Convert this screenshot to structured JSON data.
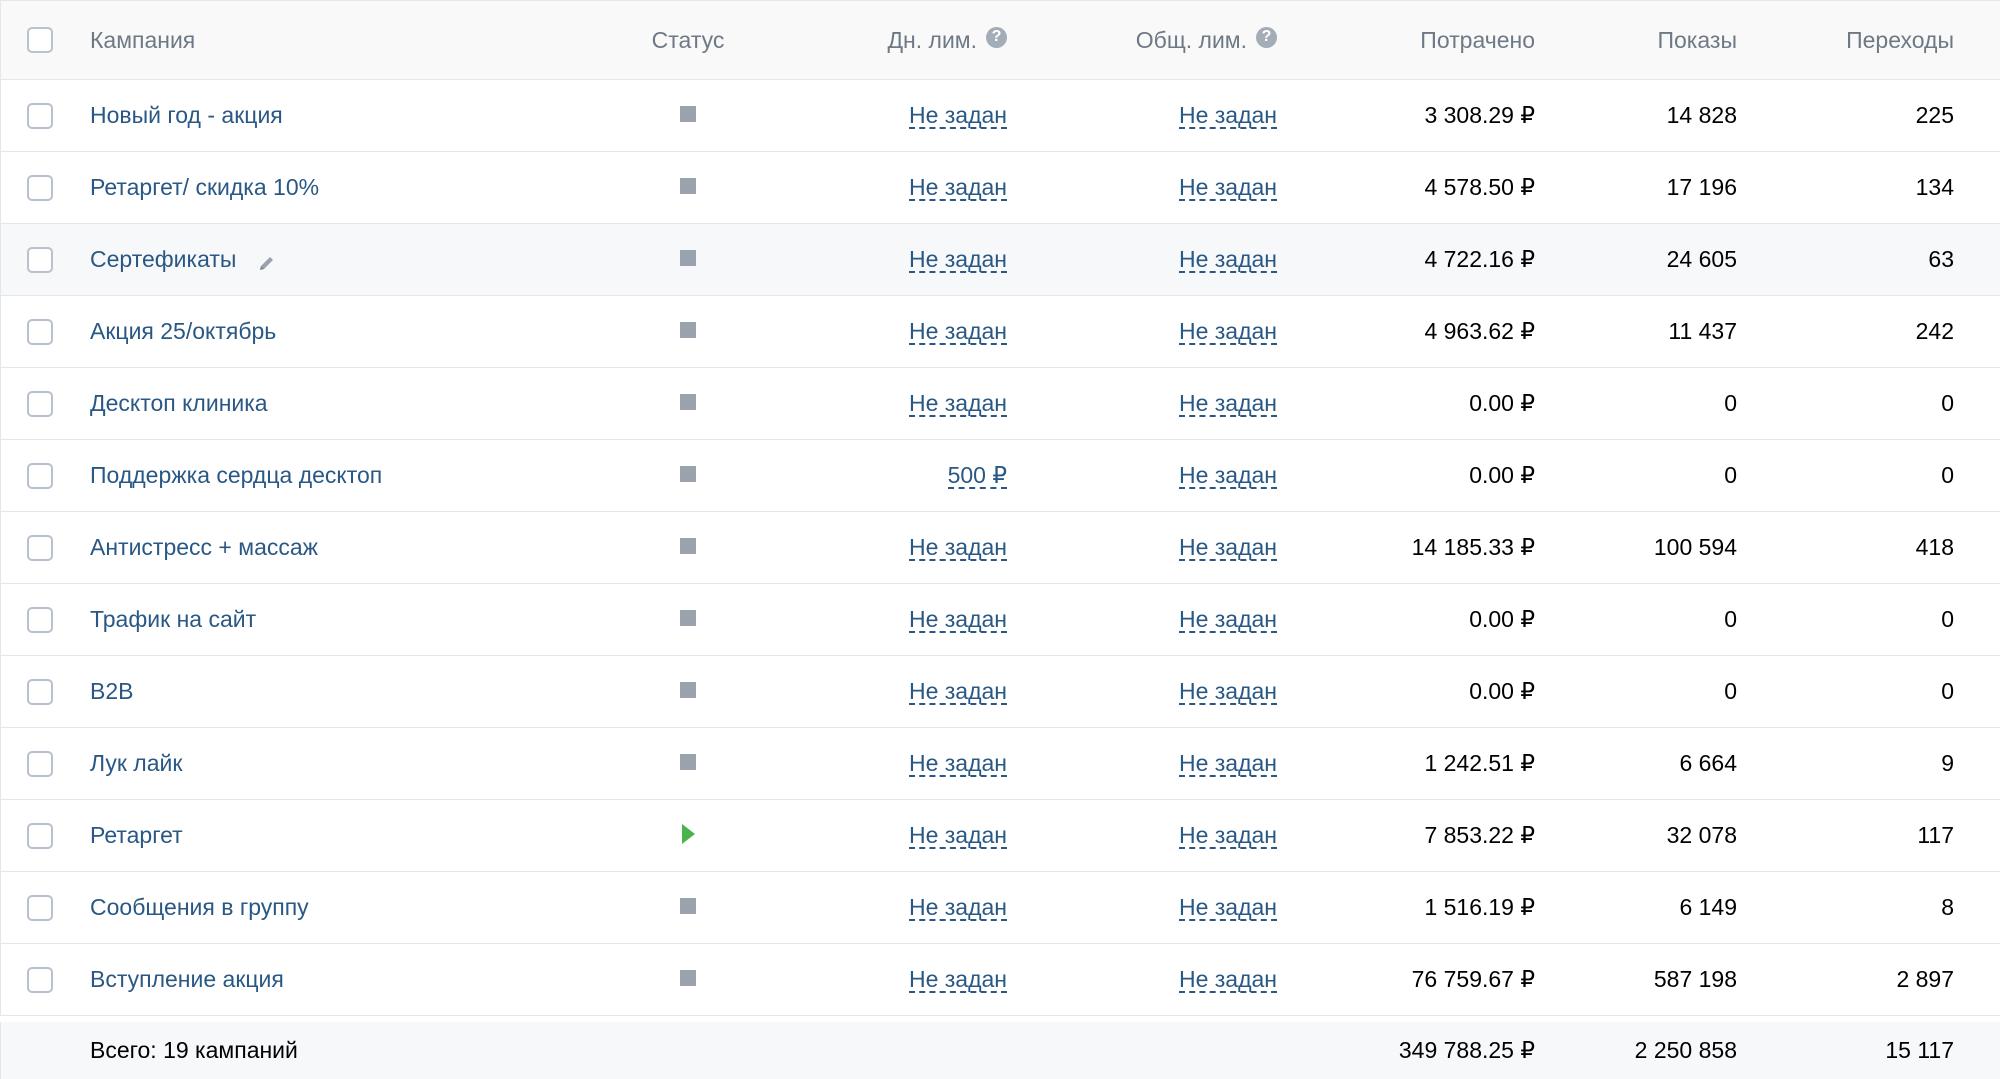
{
  "header": {
    "campaign": "Кампания",
    "status": "Статус",
    "day_limit": "Дн. лим.",
    "total_limit": "Общ. лим.",
    "spent": "Потрачено",
    "shows": "Показы",
    "clicks": "Переходы",
    "help_glyph": "?"
  },
  "rows": [
    {
      "name": "Новый год - акция",
      "status": "stopped",
      "day_limit": "Не задан",
      "total_limit": "Не задан",
      "spent": "3 308.29 ₽",
      "shows": "14 828",
      "clicks": "225"
    },
    {
      "name": "Ретаргет/ скидка 10%",
      "status": "stopped",
      "day_limit": "Не задан",
      "total_limit": "Не задан",
      "spent": "4 578.50 ₽",
      "shows": "17 196",
      "clicks": "134"
    },
    {
      "name": "Сертефикаты",
      "status": "stopped",
      "day_limit": "Не задан",
      "total_limit": "Не задан",
      "spent": "4 722.16 ₽",
      "shows": "24 605",
      "clicks": "63"
    },
    {
      "name": "Акция 25/октябрь",
      "status": "stopped",
      "day_limit": "Не задан",
      "total_limit": "Не задан",
      "spent": "4 963.62 ₽",
      "shows": "11 437",
      "clicks": "242"
    },
    {
      "name": "Десктоп клиника",
      "status": "stopped",
      "day_limit": "Не задан",
      "total_limit": "Не задан",
      "spent": "0.00 ₽",
      "shows": "0",
      "clicks": "0"
    },
    {
      "name": "Поддержка сердца десктоп",
      "status": "stopped",
      "day_limit": "500 ₽",
      "total_limit": "Не задан",
      "spent": "0.00 ₽",
      "shows": "0",
      "clicks": "0"
    },
    {
      "name": "Антистресс + массаж",
      "status": "stopped",
      "day_limit": "Не задан",
      "total_limit": "Не задан",
      "spent": "14 185.33 ₽",
      "shows": "100 594",
      "clicks": "418"
    },
    {
      "name": "Трафик на сайт",
      "status": "stopped",
      "day_limit": "Не задан",
      "total_limit": "Не задан",
      "spent": "0.00 ₽",
      "shows": "0",
      "clicks": "0"
    },
    {
      "name": "B2B",
      "status": "stopped",
      "day_limit": "Не задан",
      "total_limit": "Не задан",
      "spent": "0.00 ₽",
      "shows": "0",
      "clicks": "0"
    },
    {
      "name": "Лук лайк",
      "status": "stopped",
      "day_limit": "Не задан",
      "total_limit": "Не задан",
      "spent": "1 242.51 ₽",
      "shows": "6 664",
      "clicks": "9"
    },
    {
      "name": "Ретаргет",
      "status": "running",
      "day_limit": "Не задан",
      "total_limit": "Не задан",
      "spent": "7 853.22 ₽",
      "shows": "32 078",
      "clicks": "117"
    },
    {
      "name": "Сообщения в группу",
      "status": "stopped",
      "day_limit": "Не задан",
      "total_limit": "Не задан",
      "spent": "1 516.19 ₽",
      "shows": "6 149",
      "clicks": "8"
    },
    {
      "name": "Вступление акция",
      "status": "stopped",
      "day_limit": "Не задан",
      "total_limit": "Не задан",
      "spent": "76 759.67 ₽",
      "shows": "587 198",
      "clicks": "2 897"
    }
  ],
  "footer": {
    "label": "Всего: 19 кампаний",
    "spent": "349 788.25 ₽",
    "shows": "2 250 858",
    "clicks": "15 117"
  },
  "colors": {
    "link": "#2a5885",
    "status_stopped": "#99a2ad",
    "status_running": "#4bb34b",
    "border": "#e4e6e9"
  },
  "icons": {
    "status_stopped": "stop-square-icon",
    "status_running": "play-triangle-icon",
    "edit": "pencil-icon",
    "help": "question-circle-icon"
  }
}
